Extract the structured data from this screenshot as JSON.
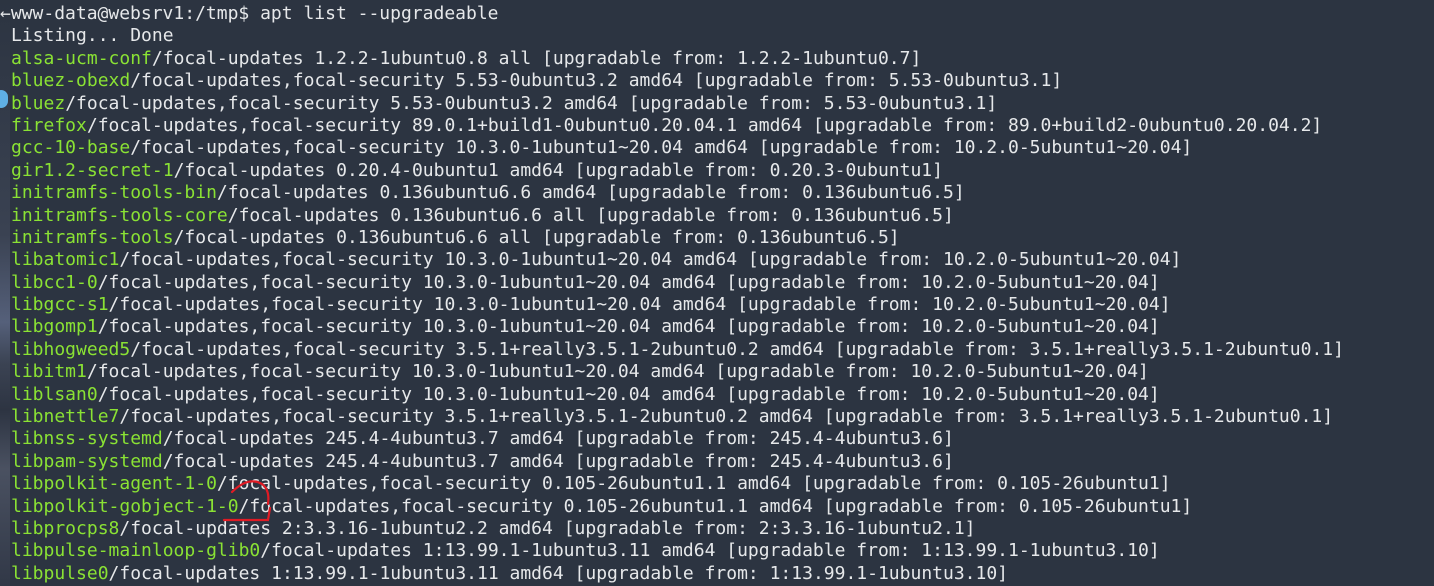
{
  "prompt": {
    "prefix": "←",
    "text": "www-data@websrv1:/tmp$ apt list --upgradeable"
  },
  "status": "Listing... Done",
  "packages": [
    {
      "name": "alsa-ucm-conf",
      "rest": "/focal-updates 1.2.2-1ubuntu0.8 all [upgradable from: 1.2.2-1ubuntu0.7]"
    },
    {
      "name": "bluez-obexd",
      "rest": "/focal-updates,focal-security 5.53-0ubuntu3.2 amd64 [upgradable from: 5.53-0ubuntu3.1]"
    },
    {
      "name": "bluez",
      "rest": "/focal-updates,focal-security 5.53-0ubuntu3.2 amd64 [upgradable from: 5.53-0ubuntu3.1]"
    },
    {
      "name": "firefox",
      "rest": "/focal-updates,focal-security 89.0.1+build1-0ubuntu0.20.04.1 amd64 [upgradable from: 89.0+build2-0ubuntu0.20.04.2]"
    },
    {
      "name": "gcc-10-base",
      "rest": "/focal-updates,focal-security 10.3.0-1ubuntu1~20.04 amd64 [upgradable from: 10.2.0-5ubuntu1~20.04]"
    },
    {
      "name": "gir1.2-secret-1",
      "rest": "/focal-updates 0.20.4-0ubuntu1 amd64 [upgradable from: 0.20.3-0ubuntu1]"
    },
    {
      "name": "initramfs-tools-bin",
      "rest": "/focal-updates 0.136ubuntu6.6 amd64 [upgradable from: 0.136ubuntu6.5]"
    },
    {
      "name": "initramfs-tools-core",
      "rest": "/focal-updates 0.136ubuntu6.6 all [upgradable from: 0.136ubuntu6.5]"
    },
    {
      "name": "initramfs-tools",
      "rest": "/focal-updates 0.136ubuntu6.6 all [upgradable from: 0.136ubuntu6.5]"
    },
    {
      "name": "libatomic1",
      "rest": "/focal-updates,focal-security 10.3.0-1ubuntu1~20.04 amd64 [upgradable from: 10.2.0-5ubuntu1~20.04]"
    },
    {
      "name": "libcc1-0",
      "rest": "/focal-updates,focal-security 10.3.0-1ubuntu1~20.04 amd64 [upgradable from: 10.2.0-5ubuntu1~20.04]"
    },
    {
      "name": "libgcc-s1",
      "rest": "/focal-updates,focal-security 10.3.0-1ubuntu1~20.04 amd64 [upgradable from: 10.2.0-5ubuntu1~20.04]"
    },
    {
      "name": "libgomp1",
      "rest": "/focal-updates,focal-security 10.3.0-1ubuntu1~20.04 amd64 [upgradable from: 10.2.0-5ubuntu1~20.04]"
    },
    {
      "name": "libhogweed5",
      "rest": "/focal-updates,focal-security 3.5.1+really3.5.1-2ubuntu0.2 amd64 [upgradable from: 3.5.1+really3.5.1-2ubuntu0.1]"
    },
    {
      "name": "libitm1",
      "rest": "/focal-updates,focal-security 10.3.0-1ubuntu1~20.04 amd64 [upgradable from: 10.2.0-5ubuntu1~20.04]"
    },
    {
      "name": "liblsan0",
      "rest": "/focal-updates,focal-security 10.3.0-1ubuntu1~20.04 amd64 [upgradable from: 10.2.0-5ubuntu1~20.04]"
    },
    {
      "name": "libnettle7",
      "rest": "/focal-updates,focal-security 3.5.1+really3.5.1-2ubuntu0.2 amd64 [upgradable from: 3.5.1+really3.5.1-2ubuntu0.1]"
    },
    {
      "name": "libnss-systemd",
      "rest": "/focal-updates 245.4-4ubuntu3.7 amd64 [upgradable from: 245.4-4ubuntu3.6]"
    },
    {
      "name": "libpam-systemd",
      "rest": "/focal-updates 245.4-4ubuntu3.7 amd64 [upgradable from: 245.4-4ubuntu3.6]"
    },
    {
      "name": "libpolkit-agent-1-0",
      "rest": "/focal-updates,focal-security 0.105-26ubuntu1.1 amd64 [upgradable from: 0.105-26ubuntu1]"
    },
    {
      "name": "libpolkit-gobject-1-0",
      "rest": "/focal-updates,focal-security 0.105-26ubuntu1.1 amd64 [upgradable from: 0.105-26ubuntu1]"
    },
    {
      "name": "libprocps8",
      "rest": "/focal-updates 2:3.3.16-1ubuntu2.2 amd64 [upgradable from: 2:3.3.16-1ubuntu2.1]"
    },
    {
      "name": "libpulse-mainloop-glib0",
      "rest": "/focal-updates 1:13.99.1-1ubuntu3.11 amd64 [upgradable from: 1:13.99.1-1ubuntu3.10]"
    },
    {
      "name": "libpulse0",
      "rest": "/focal-updates 1:13.99.1-1ubuntu3.11 amd64 [upgradable from: 1:13.99.1-1ubuntu3.10]"
    }
  ],
  "colors": {
    "background": "#2c3441",
    "package_name": "#8ae234",
    "text": "#e6e8ea",
    "annotation": "#e01b24"
  }
}
